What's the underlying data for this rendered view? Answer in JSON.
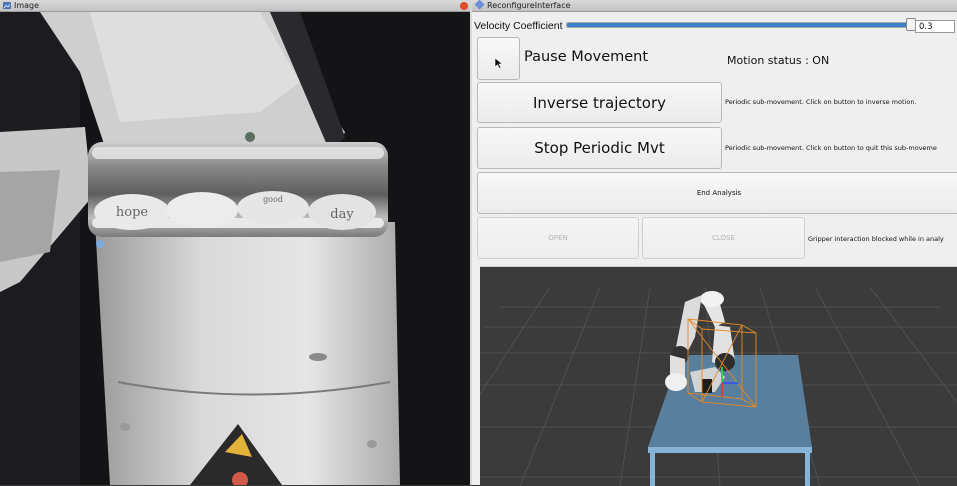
{
  "left_panel": {
    "title": "Image",
    "icons": {
      "title": "image-window-icon",
      "close": "close-icon"
    },
    "camera": {
      "plate_labels": [
        "hope",
        "",
        "good",
        "day"
      ]
    }
  },
  "right_panel": {
    "title": "ReconfigureInterface",
    "velocity": {
      "label": "Velocity Coefficient",
      "value": "0.3",
      "fraction": 0.99
    },
    "pause_button": "Pause Movement",
    "motion_status": "Motion status : ON",
    "inverse_button": "Inverse trajectory",
    "inverse_note": "Periodic sub-movement. Click on button to inverse motion.",
    "stop_button": "Stop Periodic Mvt",
    "stop_note": "Periodic sub-movement. Click on button to quit this sub-moveme",
    "end_button": "End Analysis",
    "open_button": "OPEN",
    "close_button": "CLOSE",
    "gripper_note": "Gripper interaction blocked while in analy"
  },
  "colors": {
    "slider_fill": "#3c7fc9",
    "table_top": "#5a7f9c",
    "table_frame": "#86b4d6",
    "bbox": "#e08a2a",
    "close_dot": "#e04a2a"
  }
}
